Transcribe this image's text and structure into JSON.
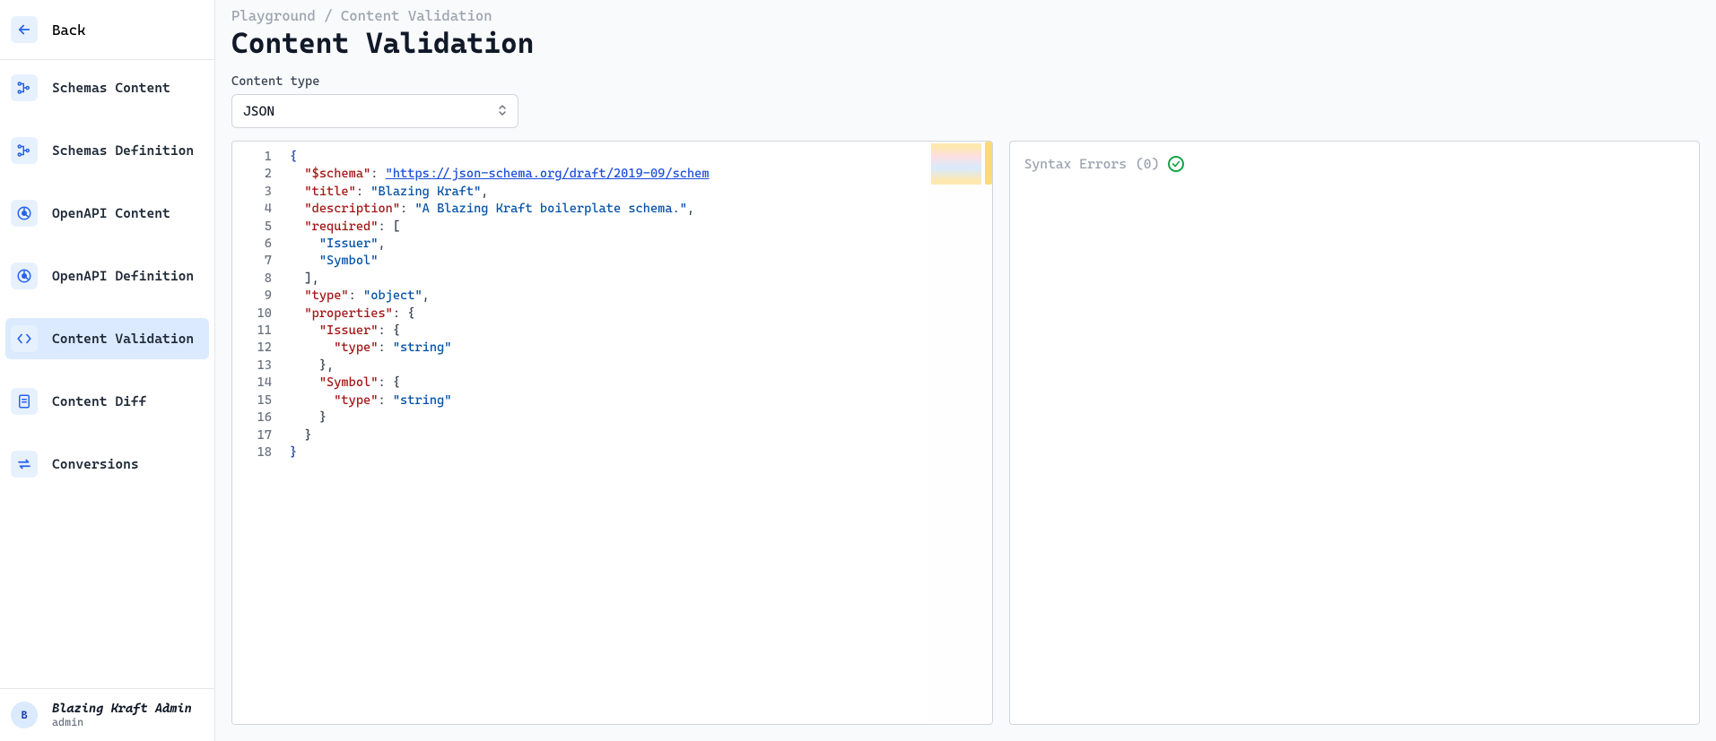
{
  "sidebar": {
    "back_label": "Back",
    "items": [
      {
        "label": "Schemas Content",
        "icon": "schema-icon",
        "active": false
      },
      {
        "label": "Schemas Definition",
        "icon": "schema-icon",
        "active": false
      },
      {
        "label": "OpenAPI Content",
        "icon": "openapi-icon",
        "active": false
      },
      {
        "label": "OpenAPI Definition",
        "icon": "openapi-icon",
        "active": false
      },
      {
        "label": "Content Validation",
        "icon": "code-icon",
        "active": true
      },
      {
        "label": "Content Diff",
        "icon": "diff-icon",
        "active": false
      },
      {
        "label": "Conversions",
        "icon": "conversions-icon",
        "active": false
      }
    ]
  },
  "user": {
    "avatar_initial": "B",
    "name": "Blazing Kraft Admin",
    "role": "admin"
  },
  "breadcrumb": {
    "parent": "Playground",
    "separator": "/",
    "current": "Content Validation"
  },
  "page_title": "Content Validation",
  "content_type": {
    "label": "Content type",
    "value": "JSON"
  },
  "editor": {
    "lines": [
      {
        "n": 1,
        "tokens": [
          {
            "t": "{",
            "c": "brace"
          }
        ]
      },
      {
        "n": 2,
        "tokens": [
          {
            "t": "  ",
            "c": ""
          },
          {
            "t": "\"$schema\"",
            "c": "key"
          },
          {
            "t": ": ",
            "c": "punct"
          },
          {
            "t": "\"https://json-schema.org/draft/2019-09/schem",
            "c": "url"
          }
        ]
      },
      {
        "n": 3,
        "tokens": [
          {
            "t": "  ",
            "c": ""
          },
          {
            "t": "\"title\"",
            "c": "key"
          },
          {
            "t": ": ",
            "c": "punct"
          },
          {
            "t": "\"Blazing Kraft\"",
            "c": "str"
          },
          {
            "t": ",",
            "c": "punct"
          }
        ]
      },
      {
        "n": 4,
        "tokens": [
          {
            "t": "  ",
            "c": ""
          },
          {
            "t": "\"description\"",
            "c": "key"
          },
          {
            "t": ": ",
            "c": "punct"
          },
          {
            "t": "\"A Blazing Kraft boilerplate schema.\"",
            "c": "str"
          },
          {
            "t": ",",
            "c": "punct"
          }
        ]
      },
      {
        "n": 5,
        "tokens": [
          {
            "t": "  ",
            "c": ""
          },
          {
            "t": "\"required\"",
            "c": "key"
          },
          {
            "t": ": [",
            "c": "punct"
          }
        ]
      },
      {
        "n": 6,
        "tokens": [
          {
            "t": "    ",
            "c": ""
          },
          {
            "t": "\"Issuer\"",
            "c": "str"
          },
          {
            "t": ",",
            "c": "punct"
          }
        ]
      },
      {
        "n": 7,
        "tokens": [
          {
            "t": "    ",
            "c": ""
          },
          {
            "t": "\"Symbol\"",
            "c": "str"
          }
        ]
      },
      {
        "n": 8,
        "tokens": [
          {
            "t": "  ",
            "c": ""
          },
          {
            "t": "],",
            "c": "punct"
          }
        ]
      },
      {
        "n": 9,
        "tokens": [
          {
            "t": "  ",
            "c": ""
          },
          {
            "t": "\"type\"",
            "c": "key"
          },
          {
            "t": ": ",
            "c": "punct"
          },
          {
            "t": "\"object\"",
            "c": "str"
          },
          {
            "t": ",",
            "c": "punct"
          }
        ]
      },
      {
        "n": 10,
        "tokens": [
          {
            "t": "  ",
            "c": ""
          },
          {
            "t": "\"properties\"",
            "c": "key"
          },
          {
            "t": ": {",
            "c": "punct"
          }
        ]
      },
      {
        "n": 11,
        "tokens": [
          {
            "t": "    ",
            "c": ""
          },
          {
            "t": "\"Issuer\"",
            "c": "key"
          },
          {
            "t": ": {",
            "c": "punct"
          }
        ]
      },
      {
        "n": 12,
        "tokens": [
          {
            "t": "      ",
            "c": ""
          },
          {
            "t": "\"type\"",
            "c": "key"
          },
          {
            "t": ": ",
            "c": "punct"
          },
          {
            "t": "\"string\"",
            "c": "str"
          }
        ]
      },
      {
        "n": 13,
        "tokens": [
          {
            "t": "    ",
            "c": ""
          },
          {
            "t": "},",
            "c": "punct"
          }
        ]
      },
      {
        "n": 14,
        "tokens": [
          {
            "t": "    ",
            "c": ""
          },
          {
            "t": "\"Symbol\"",
            "c": "key"
          },
          {
            "t": ": {",
            "c": "punct"
          }
        ]
      },
      {
        "n": 15,
        "tokens": [
          {
            "t": "      ",
            "c": ""
          },
          {
            "t": "\"type\"",
            "c": "key"
          },
          {
            "t": ": ",
            "c": "punct"
          },
          {
            "t": "\"string\"",
            "c": "str"
          }
        ]
      },
      {
        "n": 16,
        "tokens": [
          {
            "t": "    ",
            "c": ""
          },
          {
            "t": "}",
            "c": "punct"
          }
        ]
      },
      {
        "n": 17,
        "tokens": [
          {
            "t": "  ",
            "c": ""
          },
          {
            "t": "}",
            "c": "punct"
          }
        ]
      },
      {
        "n": 18,
        "tokens": [
          {
            "t": "}",
            "c": "brace"
          }
        ]
      }
    ]
  },
  "errors_panel": {
    "label": "Syntax Errors",
    "count": 0
  }
}
